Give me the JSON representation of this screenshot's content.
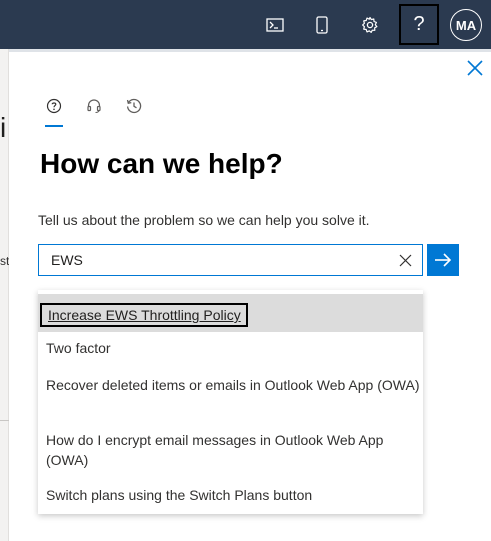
{
  "topbar": {
    "terminal_icon": "cloud-shell-icon",
    "mobile_icon": "mobile-app-icon",
    "settings_icon": "gear-icon",
    "help_label": "?",
    "avatar_initials": "MA"
  },
  "background": {
    "glyph_top": "i",
    "glyph_mid": "st"
  },
  "panel": {
    "tabs": [
      {
        "icon": "help-circle-icon",
        "active": true
      },
      {
        "icon": "headset-icon",
        "active": false
      },
      {
        "icon": "history-icon",
        "active": false
      }
    ],
    "title": "How can we help?",
    "subtitle": "Tell us about the problem so we can help you solve it.",
    "search": {
      "value": "EWS",
      "placeholder": ""
    },
    "suggestions": [
      "Increase EWS Throttling Policy",
      "Two factor",
      "Recover deleted items or emails in Outlook Web App (OWA)",
      "How do I encrypt email messages in Outlook Web App (OWA)",
      "Switch plans using the Switch Plans button"
    ]
  },
  "colors": {
    "topbar": "#2b3a50",
    "accent": "#0078d4",
    "highlight_row": "#dcdcdc"
  }
}
